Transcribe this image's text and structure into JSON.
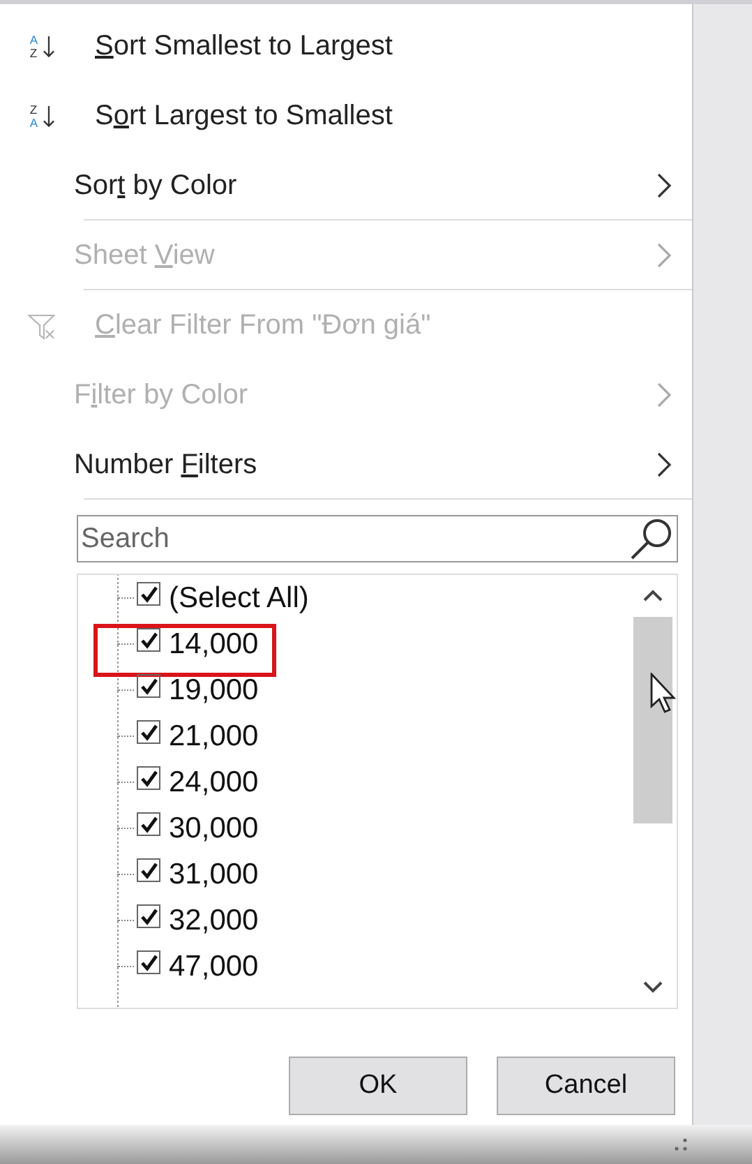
{
  "menu": [
    {
      "kind": "sort-ascending",
      "icon_letters": [
        "A",
        "Z"
      ],
      "key": "S",
      "post": "ort Smallest to Largest",
      "disabled": false,
      "submenu": false,
      "separator_after": false
    },
    {
      "kind": "sort-descending",
      "icon_letters": [
        "Z",
        "A"
      ],
      "pre": "S",
      "key": "o",
      "post": "rt Largest to Smallest",
      "disabled": false,
      "submenu": false,
      "separator_after": false
    },
    {
      "kind": "plain",
      "pre": "Sor",
      "key": "t",
      "post": " by Color",
      "disabled": false,
      "submenu": true,
      "separator_after": true
    },
    {
      "kind": "plain",
      "pre": "Sheet ",
      "key": "V",
      "post": "iew",
      "disabled": true,
      "submenu": true,
      "separator_after": true
    },
    {
      "kind": "clear-filter",
      "key": "C",
      "post": "lear Filter From \"Đơn giá\"",
      "disabled": true,
      "submenu": false,
      "separator_after": false
    },
    {
      "kind": "plain",
      "pre": "F",
      "key": "i",
      "post": "lter by Color",
      "disabled": true,
      "submenu": true,
      "separator_after": false
    },
    {
      "kind": "plain",
      "pre": "Number ",
      "key": "F",
      "post": "ilters",
      "disabled": false,
      "submenu": true,
      "separator_after": true
    }
  ],
  "search": {
    "placeholder": "Search"
  },
  "values": [
    {
      "label": "(Select All)",
      "checked": true,
      "highlighted": false
    },
    {
      "label": "14,000",
      "checked": true,
      "highlighted": true
    },
    {
      "label": "19,000",
      "checked": true,
      "highlighted": false
    },
    {
      "label": "21,000",
      "checked": true,
      "highlighted": false
    },
    {
      "label": "24,000",
      "checked": true,
      "highlighted": false
    },
    {
      "label": "30,000",
      "checked": true,
      "highlighted": false
    },
    {
      "label": "31,000",
      "checked": true,
      "highlighted": false
    },
    {
      "label": "32,000",
      "checked": true,
      "highlighted": false
    },
    {
      "label": "47,000",
      "checked": true,
      "highlighted": false
    }
  ],
  "buttons": [
    "OK",
    "Cancel"
  ]
}
